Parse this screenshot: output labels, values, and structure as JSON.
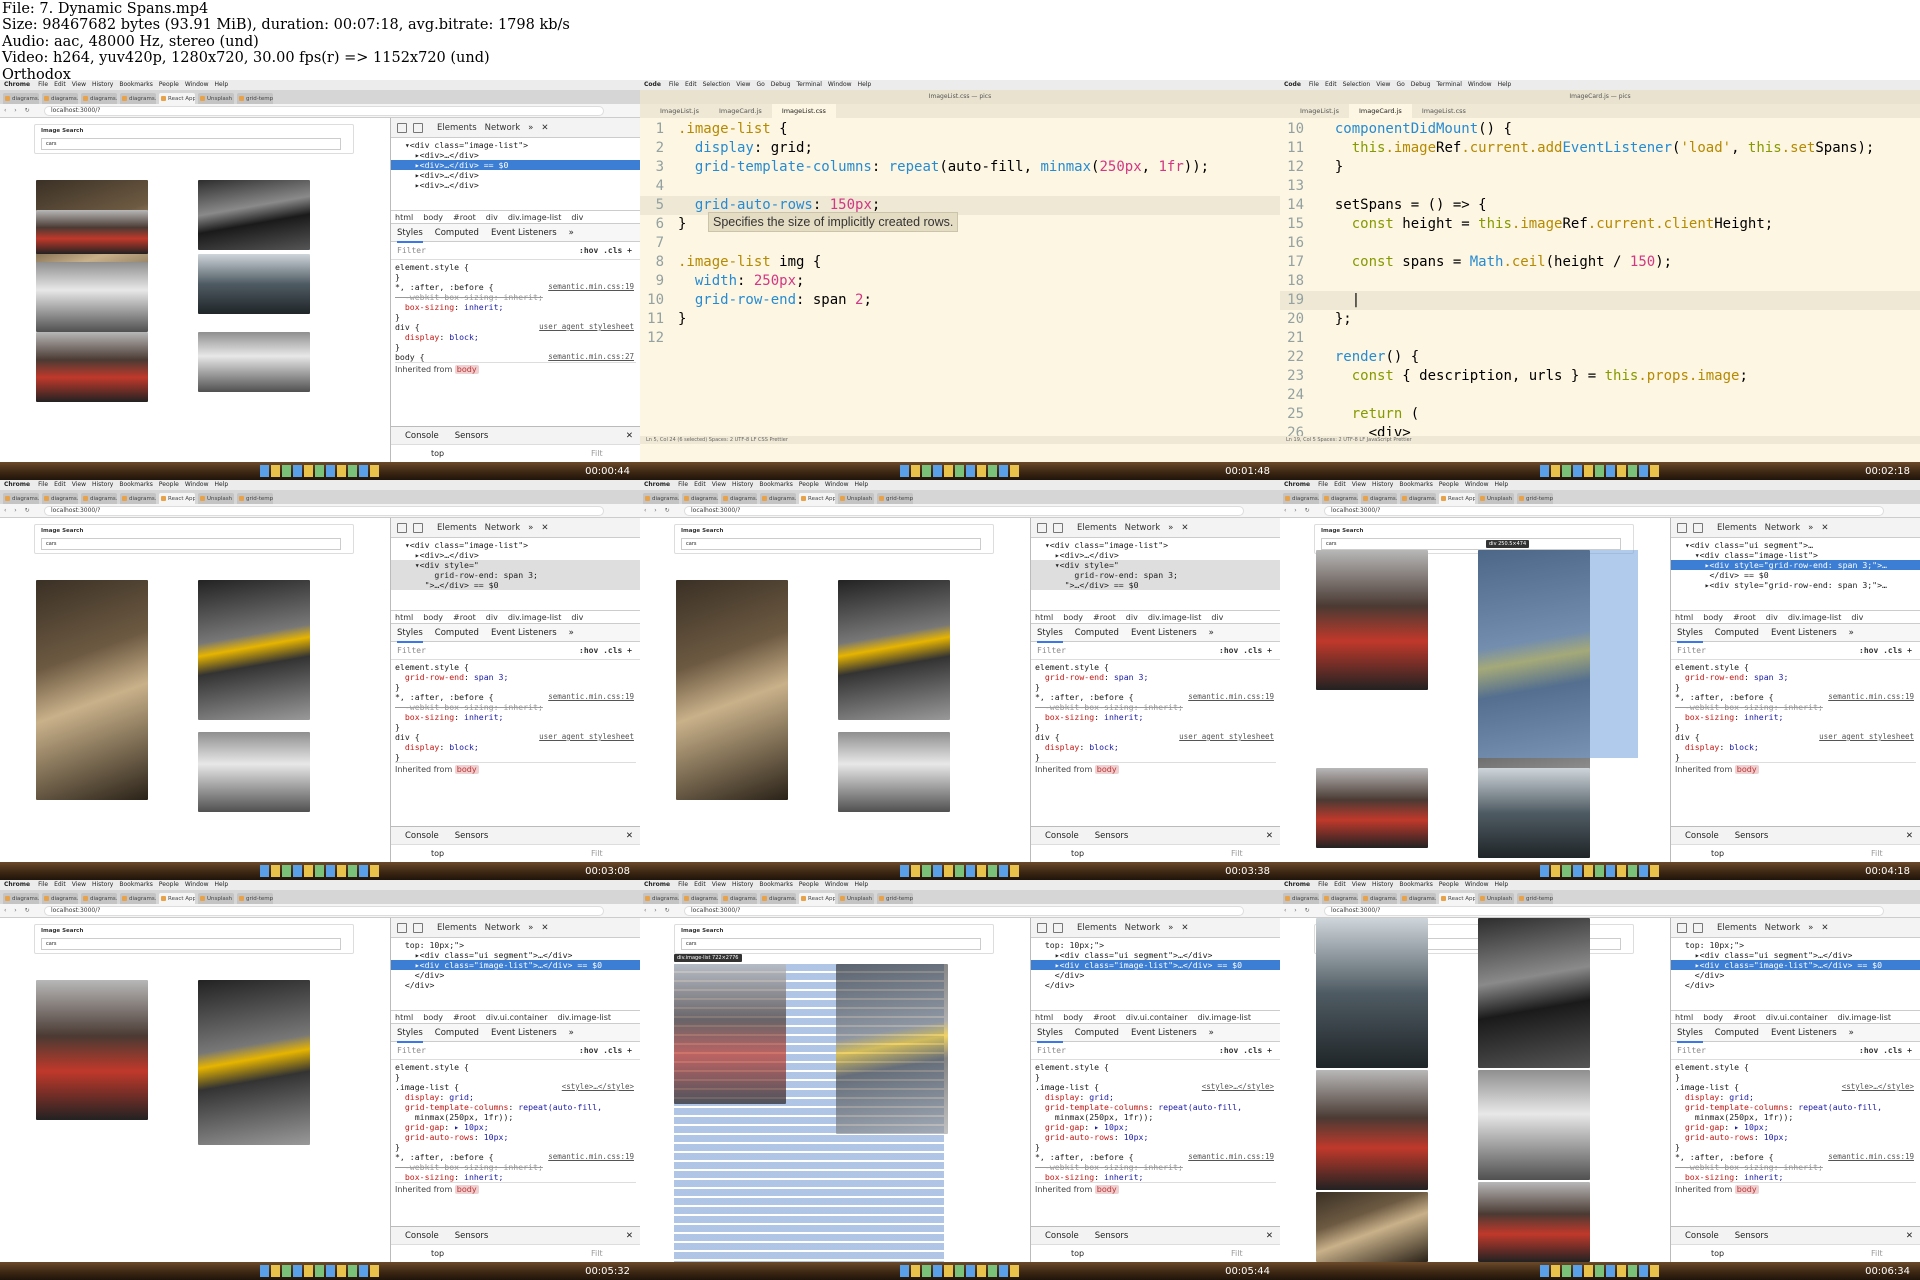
{
  "header": {
    "lines": [
      "File: 7. Dynamic Spans.mp4",
      "Size: 98467682 bytes (93.91 MiB), duration: 00:07:18, avg.bitrate: 1798 kb/s",
      "Audio: aac, 48000 Hz, stereo (und)",
      "Video: h264, yuv420p, 1280x720, 30.00 fps(r) => 1152x720 (und)",
      "Orthodox"
    ]
  },
  "chrome": {
    "menu": {
      "app": "Chrome",
      "items": [
        "File",
        "Edit",
        "View",
        "History",
        "Bookmarks",
        "People",
        "Window",
        "Help"
      ]
    },
    "url": "localhost:3000/?",
    "tabs": [
      "diagrams.xml",
      "diagrams.xml",
      "diagrams.xml",
      "diagrams.xml",
      "React App",
      "Unsplash API Do",
      "grid-template"
    ],
    "page_title": "Image Search",
    "search_value": "cars",
    "devtools": {
      "elements_tab": "Elements",
      "network_tab": "Network",
      "styles_tab": "Styles",
      "computed_tab": "Computed",
      "listeners_tab": "Event Listeners",
      "filter": "Filter",
      "hov": ":hov .cls +",
      "console": "Console",
      "sensors": "Sensors",
      "top": "top",
      "filt": "Filt",
      "inherited": "Inherited from",
      "body": "body"
    }
  },
  "vscode": {
    "menu": {
      "app": "Code",
      "items": [
        "File",
        "Edit",
        "Selection",
        "View",
        "Go",
        "Debug",
        "Terminal",
        "Window",
        "Help"
      ]
    },
    "frame2": {
      "title": "ImageList.css — pics",
      "tabs": [
        "ImageList.js",
        "ImageCard.js",
        "ImageList.css"
      ],
      "status": "Ln 5, Col 24 (6 selected)   Spaces: 2   UTF-8   LF   CSS   Prettier",
      "lines": [
        {
          "n": "1",
          "t": ".image-list {"
        },
        {
          "n": "2",
          "t": "  display: grid;"
        },
        {
          "n": "3",
          "t": "  grid-template-columns: repeat(auto-fill, minmax(250px, 1fr));"
        },
        {
          "n": "4",
          "t": ""
        },
        {
          "n": "5",
          "t": "  grid-auto-rows: 150px;"
        },
        {
          "n": "6",
          "t": "}"
        },
        {
          "n": "7",
          "t": ""
        },
        {
          "n": "8",
          "t": ".image-list img {"
        },
        {
          "n": "9",
          "t": "  width: 250px;"
        },
        {
          "n": "10",
          "t": "  grid-row-end: span 2;"
        },
        {
          "n": "11",
          "t": "}"
        },
        {
          "n": "12",
          "t": ""
        }
      ],
      "tooltip": "Specifies the size of implicitly created rows."
    },
    "frame3": {
      "title": "ImageCard.js — pics",
      "tabs": [
        "ImageList.js",
        "ImageCard.js",
        "ImageList.css"
      ],
      "status": "Ln 19, Col 5   Spaces: 2   UTF-8   LF   JavaScript   Prettier",
      "lines": [
        {
          "n": "10",
          "t": "  componentDidMount() {"
        },
        {
          "n": "11",
          "t": "    this.imageRef.current.addEventListener('load', this.setSpans);"
        },
        {
          "n": "12",
          "t": "  }"
        },
        {
          "n": "13",
          "t": ""
        },
        {
          "n": "14",
          "t": "  setSpans = () => {"
        },
        {
          "n": "15",
          "t": "    const height = this.imageRef.current.clientHeight;"
        },
        {
          "n": "16",
          "t": ""
        },
        {
          "n": "17",
          "t": "    const spans = Math.ceil(height / 150);"
        },
        {
          "n": "18",
          "t": ""
        },
        {
          "n": "19",
          "t": "    |"
        },
        {
          "n": "20",
          "t": "  };"
        },
        {
          "n": "21",
          "t": ""
        },
        {
          "n": "22",
          "t": "  render() {"
        },
        {
          "n": "23",
          "t": "    const { description, urls } = this.props.image;"
        },
        {
          "n": "24",
          "t": ""
        },
        {
          "n": "25",
          "t": "    return ("
        },
        {
          "n": "26",
          "t": "      <div>"
        }
      ]
    }
  },
  "frames": [
    {
      "time": "00:00:44",
      "crumbs": [
        "html",
        "body",
        "#root",
        "div",
        "div.image-list",
        "div"
      ],
      "tree": [
        "  ▾<div class=\"image-list\">",
        "    ▸<div>…</div>",
        "    ▸<div>…</div> == $0",
        "    ▸<div>…</div>",
        "    ▸<div>…</div>"
      ],
      "sel": 2,
      "rules": [
        "element.style {",
        "}",
        "*, :after, :before {",
        "  -webkit-box-sizing: inherit;",
        "  box-sizing: inherit;",
        "}",
        "div {",
        "  display: block;",
        "}"
      ],
      "srcs": [
        "",
        "",
        "semantic.min.css:19",
        "",
        "",
        "",
        "user agent stylesheet",
        "",
        ""
      ],
      "tail": "body {",
      "tailsrc": "semantic.min.css:27"
    },
    {
      "time": "00:01:48"
    },
    {
      "time": "00:02:18"
    },
    {
      "time": "00:03:08",
      "crumbs": [
        "html",
        "body",
        "#root",
        "div",
        "div.image-list",
        "div"
      ],
      "tree": [
        "  ▾<div class=\"image-list\">",
        "    ▸<div>…</div>",
        "    ▾<div style=\"",
        "        grid-row-end: span 3;",
        "      \">…</div> == $0"
      ],
      "sel": -1,
      "rules": [
        "element.style {",
        "  grid-row-end: span 3;",
        "}",
        "*, :after, :before {",
        "  -webkit-box-sizing: inherit;",
        "  box-sizing: inherit;",
        "}",
        "div {",
        "  display: block;",
        "}"
      ],
      "srcs": [
        "",
        "",
        "",
        "semantic.min.css:19",
        "",
        "",
        "",
        "user agent stylesheet",
        "",
        ""
      ]
    },
    {
      "time": "00:03:38",
      "crumbs": [
        "html",
        "body",
        "#root",
        "div",
        "div.image-list",
        "div"
      ],
      "tree": [
        "  ▾<div class=\"image-list\">",
        "    ▸<div>…</div>",
        "    ▾<div style=\"",
        "        grid-row-end: span 3;",
        "      \">…</div> == $0"
      ],
      "sel": -1,
      "rules": [
        "element.style {",
        "  grid-row-end: span 3;",
        "}",
        "*, :after, :before {",
        "  -webkit-box-sizing: inherit;",
        "  box-sizing: inherit;",
        "}",
        "div {",
        "  display: block;",
        "}"
      ],
      "srcs": [
        "",
        "",
        "",
        "semantic.min.css:19",
        "",
        "",
        "",
        "user agent stylesheet",
        "",
        ""
      ]
    },
    {
      "time": "00:04:18",
      "crumbs": [
        "html",
        "body",
        "#root",
        "div",
        "div.image-list",
        "div"
      ],
      "hover": "div 250.5×474",
      "tree": [
        "  ▾<div class=\"ui segment\">…",
        "    ▾<div class=\"image-list\">",
        "      ▸<div style=\"grid-row-end: span 3;\">…",
        "       </div> == $0",
        "      ▸<div style=\"grid-row-end: span 3;\">…"
      ],
      "sel": 2,
      "rules": [
        "element.style {",
        "  grid-row-end: span 3;",
        "}",
        "*, :after, :before {",
        "  -webkit-box-sizing: inherit;",
        "  box-sizing: inherit;",
        "}",
        "div {",
        "  display: block;",
        "}"
      ],
      "srcs": [
        "",
        "",
        "",
        "semantic.min.css:19",
        "",
        "",
        "",
        "user agent stylesheet",
        "",
        ""
      ]
    },
    {
      "time": "00:05:32",
      "crumbs": [
        "html",
        "body",
        "#root",
        "div.ui.container",
        "div.image-list"
      ],
      "tree": [
        "  top: 10px;\">",
        "    ▸<div class=\"ui segment\">…</div>",
        "    ▸<div class=\"image-list\">…</div> == $0",
        "    </div>",
        "  </div>"
      ],
      "sel": 2,
      "rules": [
        "element.style {",
        "}",
        ".image-list {",
        "  display: grid;",
        "  grid-template-columns: repeat(auto-fill,",
        "    minmax(250px, 1fr));",
        "  grid-gap: ▸ 10px;",
        "  grid-auto-rows: 10px;",
        "}",
        "*, :after, :before {",
        "  -webkit-box-sizing: inherit;",
        "  box-sizing: inherit;"
      ],
      "srcs": [
        "",
        "",
        "<style>…</style>",
        "",
        "",
        "",
        "",
        "",
        "",
        "semantic.min.css:19",
        "",
        ""
      ]
    },
    {
      "time": "00:05:44",
      "hover": "div.image-list  722×2776"
    },
    {
      "time": "00:06:34"
    }
  ]
}
